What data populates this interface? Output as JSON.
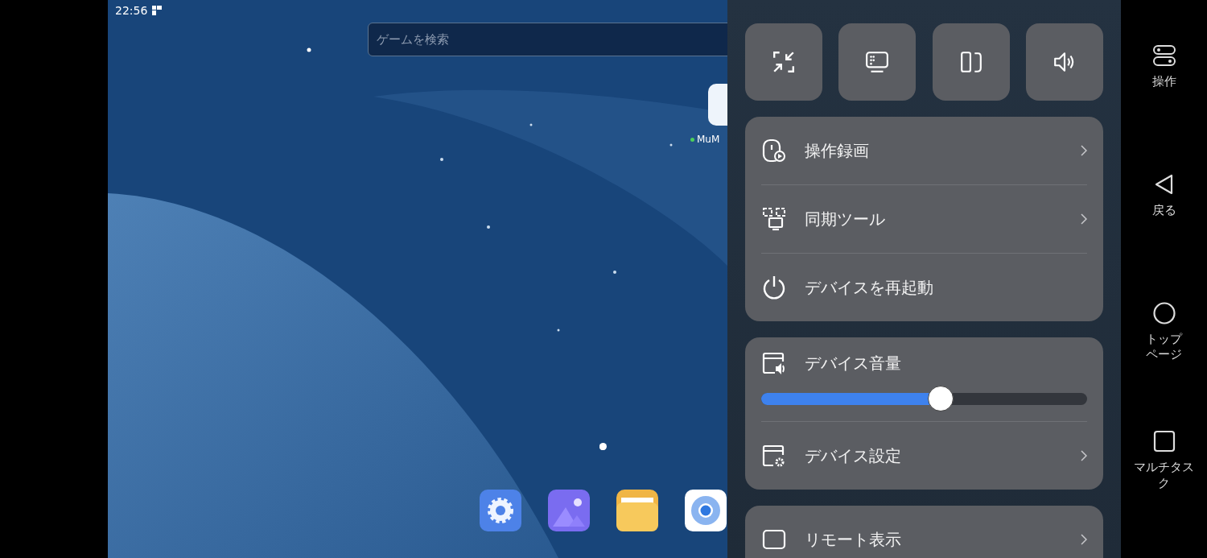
{
  "status_bar": {
    "time": "22:56"
  },
  "search": {
    "placeholder": "ゲームを検索"
  },
  "desktop_app": {
    "label": "MuM"
  },
  "dock": [
    {
      "kind": "settings"
    },
    {
      "kind": "gallery"
    },
    {
      "kind": "files"
    },
    {
      "kind": "browser"
    }
  ],
  "quick_buttons": [
    {
      "kind": "shrink"
    },
    {
      "kind": "display"
    },
    {
      "kind": "rotate"
    },
    {
      "kind": "volume"
    }
  ],
  "menu_groups": [
    {
      "items": [
        {
          "kind": "record",
          "label": "操作録画",
          "chevron": true
        },
        {
          "kind": "sync",
          "label": "同期ツール",
          "chevron": true
        },
        {
          "kind": "power",
          "label": "デバイスを再起動",
          "chevron": false
        }
      ]
    },
    {
      "items": [
        {
          "kind": "volume",
          "label": "デバイス音量",
          "level": 0.55
        },
        {
          "kind": "settings",
          "label": "デバイス設定",
          "chevron": true
        }
      ]
    },
    {
      "items": [
        {
          "kind": "remote",
          "label": "リモート表示",
          "chevron": true
        }
      ]
    }
  ],
  "nav": [
    {
      "kind": "toggles",
      "label": "操作"
    },
    {
      "kind": "back",
      "label": "戻る"
    },
    {
      "kind": "home",
      "label": "トップページ"
    },
    {
      "kind": "recent",
      "label": "マルチタスク"
    }
  ]
}
